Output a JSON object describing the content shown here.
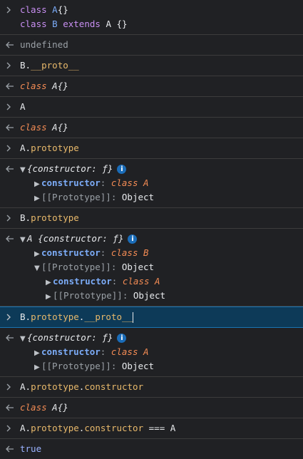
{
  "entries": [
    {
      "kind": "input",
      "lines": [
        "class A{}",
        "class B extends A {}"
      ]
    },
    {
      "kind": "output",
      "text": "undefined"
    },
    {
      "kind": "input",
      "text": "B.__proto__"
    },
    {
      "kind": "output",
      "text": "class A{}"
    },
    {
      "kind": "input",
      "text": "A"
    },
    {
      "kind": "output",
      "text": "class A{}"
    },
    {
      "kind": "input",
      "text": "A.prototype"
    },
    {
      "kind": "output",
      "summary": "{constructor: ƒ}",
      "constructor_label": "constructor",
      "constructor_value": "class A",
      "proto_label": "[[Prototype]]",
      "proto_value": "Object"
    },
    {
      "kind": "input",
      "text": "B.prototype"
    },
    {
      "kind": "output",
      "summary_prefix": "A",
      "summary": "{constructor: ƒ}",
      "constructor_label": "constructor",
      "constructor_value": "class B",
      "proto_label": "[[Prototype]]",
      "proto_value": "Object",
      "nested_constructor_label": "constructor",
      "nested_constructor_value": "class A",
      "nested_proto_label": "[[Prototype]]",
      "nested_proto_value": "Object"
    },
    {
      "kind": "input",
      "text": "B.prototype.__proto__",
      "active": true
    },
    {
      "kind": "output",
      "summary": "{constructor: ƒ}",
      "constructor_label": "constructor",
      "constructor_value": "class A",
      "proto_label": "[[Prototype]]",
      "proto_value": "Object"
    },
    {
      "kind": "input",
      "text": "A.prototype.constructor"
    },
    {
      "kind": "output",
      "text": "class A{}"
    },
    {
      "kind": "input",
      "text": "A.prototype.constructor === A"
    },
    {
      "kind": "output",
      "text": "true"
    }
  ],
  "info_glyph": "i",
  "colors": {
    "background": "#202124",
    "active": "#0d3a58",
    "keyword": "#c88ff2",
    "property": "#e8b96b",
    "class": "#f28b54"
  }
}
